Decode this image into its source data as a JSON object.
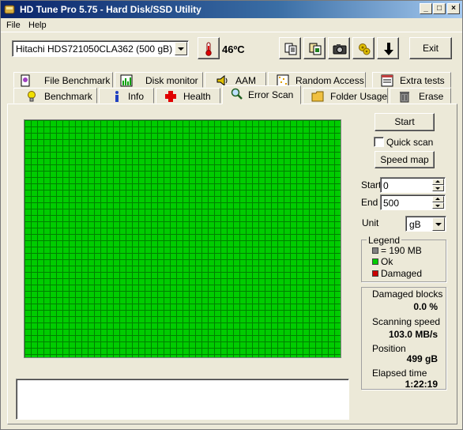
{
  "window": {
    "title": "HD Tune Pro 5.75 - Hard Disk/SSD Utility"
  },
  "menu": {
    "file": "File",
    "help": "Help"
  },
  "toolbar": {
    "drive": "Hitachi HDS721050CLA362 (500 gB)",
    "temperature": "46ºC",
    "exit_label": "Exit"
  },
  "tabs": {
    "row1": [
      "File Benchmark",
      "Disk monitor",
      "AAM",
      "Random Access",
      "Extra tests"
    ],
    "row2": [
      "Benchmark",
      "Info",
      "Health",
      "Error Scan",
      "Folder Usage",
      "Erase"
    ],
    "active": "Error Scan"
  },
  "controls": {
    "start_label": "Start",
    "quick_scan_label": "Quick scan",
    "quick_scan_checked": false,
    "speed_map_label": "Speed map",
    "start_field_label": "Start",
    "start_value": "0",
    "end_field_label": "End",
    "end_value": "500",
    "unit_label": "Unit",
    "unit_value": "gB"
  },
  "legend": {
    "title": "Legend",
    "items": [
      {
        "label": "= 190 MB",
        "color": "#808080"
      },
      {
        "label": "Ok",
        "color": "#00cc00"
      },
      {
        "label": "Damaged",
        "color": "#cc0000"
      }
    ]
  },
  "stats": {
    "damaged_label": "Damaged blocks",
    "damaged_value": "0.0 %",
    "speed_label": "Scanning speed",
    "speed_value": "103.0 MB/s",
    "position_label": "Position",
    "position_value": "499 gB",
    "elapsed_label": "Elapsed time",
    "elapsed_value": "1:22:19"
  },
  "colors": {
    "block_ok": "#00cc00",
    "grid_line": "#008000",
    "titlebar": "#0a246a"
  }
}
